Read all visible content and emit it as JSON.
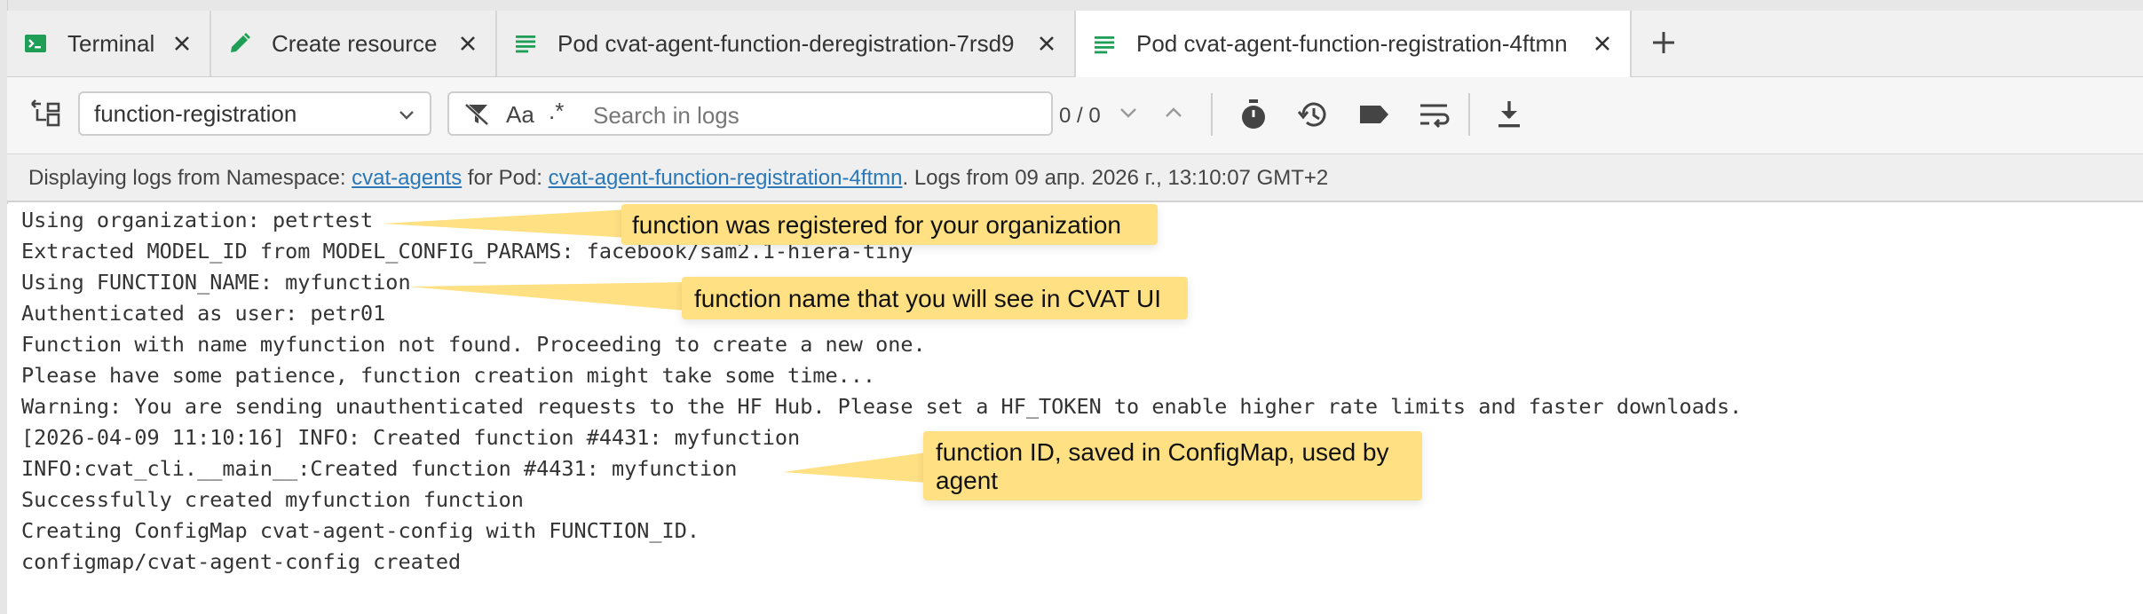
{
  "tabs": [
    {
      "label": "Terminal",
      "icon": "terminal-icon",
      "active": false
    },
    {
      "label": "Create resource",
      "icon": "pencil-icon",
      "active": false
    },
    {
      "label": "Pod cvat-agent-function-deregistration-7rsd9",
      "icon": "log-lines-icon",
      "active": false
    },
    {
      "label": "Pod cvat-agent-function-registration-4ftmn",
      "icon": "log-lines-icon",
      "active": true
    }
  ],
  "toolbar": {
    "container_select": "function-registration",
    "search_placeholder": "Search in logs",
    "case_toggle": "Aa",
    "regex_toggle": ".*",
    "match_counter": "0 / 0"
  },
  "info": {
    "prefix": "Displaying logs from Namespace: ",
    "namespace": "cvat-agents",
    "mid": " for Pod: ",
    "pod": "cvat-agent-function-registration-4ftmn",
    "suffix": ". Logs from 09 апр. 2026 г., 13:10:07 GMT+2"
  },
  "logs": [
    "Using organization: petrtest",
    "Extracted MODEL_ID from MODEL_CONFIG_PARAMS: facebook/sam2.1-hiera-tiny",
    "Using FUNCTION_NAME: myfunction",
    "Authenticated as user: petr01",
    "Function with name myfunction not found. Proceeding to create a new one.",
    "Please have some patience, function creation might take some time...",
    "Warning: You are sending unauthenticated requests to the HF Hub. Please set a HF_TOKEN to enable higher rate limits and faster downloads.",
    "[2026-04-09 11:10:16] INFO: Created function #4431: myfunction",
    "INFO:cvat_cli.__main__:Created function #4431: myfunction",
    "Successfully created myfunction function",
    "Creating ConfigMap cvat-agent-config with FUNCTION_ID.",
    "configmap/cvat-agent-config created"
  ],
  "annotations": [
    {
      "text": "function was registered for your organization"
    },
    {
      "text": "function name that you will see in CVAT UI"
    },
    {
      "text": "function ID, saved in ConfigMap, used by agent"
    }
  ],
  "colors": {
    "accent_green": "#1f9e55",
    "link_blue": "#2a78b8",
    "callout_yellow": "#ffe083"
  }
}
